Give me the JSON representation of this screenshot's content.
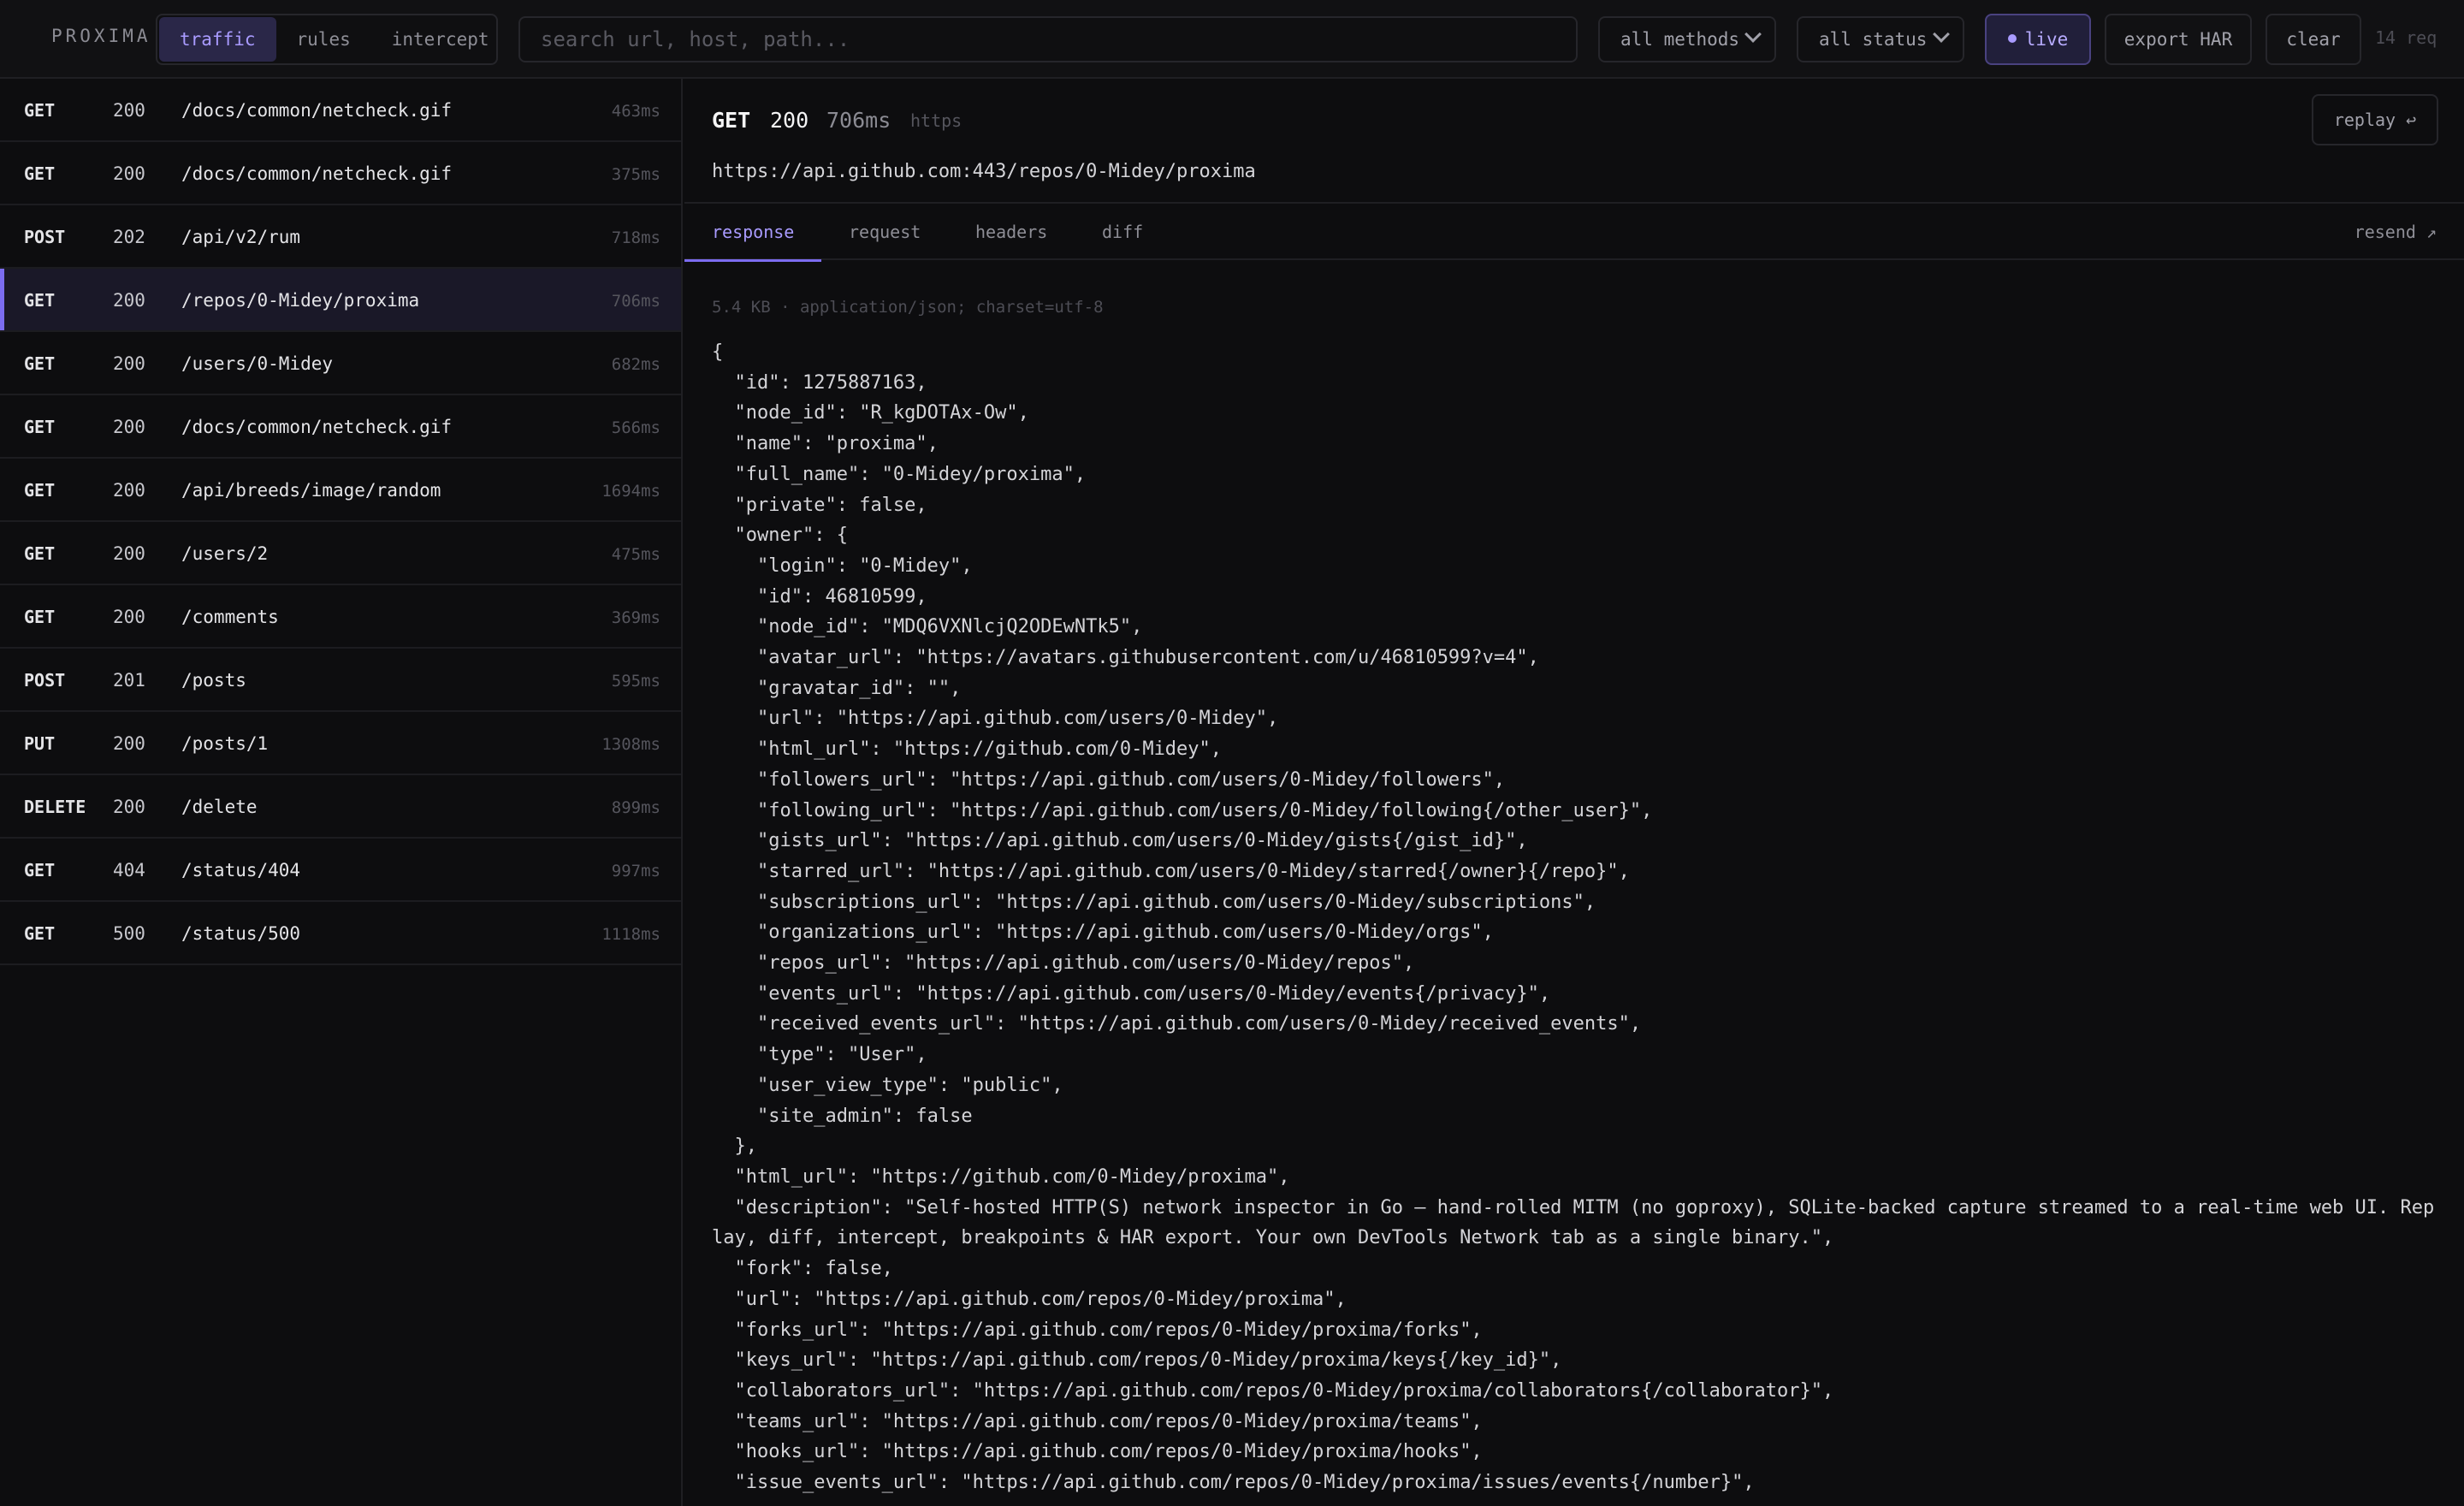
{
  "app": {
    "brand": "PROXIMA"
  },
  "nav": {
    "tabs": [
      "traffic",
      "rules",
      "intercept"
    ],
    "active": "traffic"
  },
  "search": {
    "placeholder": "search url, host, path...",
    "value": ""
  },
  "filters": {
    "methods": "all methods",
    "status": "all status"
  },
  "toolbar": {
    "live_label": "live",
    "export_label": "export HAR",
    "clear_label": "clear",
    "req_count": "14 req"
  },
  "colors": {
    "accent": "#7c6cf0",
    "accent_text": "#a99bff"
  },
  "requests": [
    {
      "method": "GET",
      "status": "200",
      "path": "/docs/common/netcheck.gif",
      "time": "463ms"
    },
    {
      "method": "GET",
      "status": "200",
      "path": "/docs/common/netcheck.gif",
      "time": "375ms"
    },
    {
      "method": "POST",
      "status": "202",
      "path": "/api/v2/rum",
      "time": "718ms"
    },
    {
      "method": "GET",
      "status": "200",
      "path": "/repos/0-Midey/proxima",
      "time": "706ms",
      "selected": true
    },
    {
      "method": "GET",
      "status": "200",
      "path": "/users/0-Midey",
      "time": "682ms"
    },
    {
      "method": "GET",
      "status": "200",
      "path": "/docs/common/netcheck.gif",
      "time": "566ms"
    },
    {
      "method": "GET",
      "status": "200",
      "path": "/api/breeds/image/random",
      "time": "1694ms"
    },
    {
      "method": "GET",
      "status": "200",
      "path": "/users/2",
      "time": "475ms"
    },
    {
      "method": "GET",
      "status": "200",
      "path": "/comments",
      "time": "369ms"
    },
    {
      "method": "POST",
      "status": "201",
      "path": "/posts",
      "time": "595ms"
    },
    {
      "method": "PUT",
      "status": "200",
      "path": "/posts/1",
      "time": "1308ms"
    },
    {
      "method": "DELETE",
      "status": "200",
      "path": "/delete",
      "time": "899ms"
    },
    {
      "method": "GET",
      "status": "404",
      "path": "/status/404",
      "time": "997ms"
    },
    {
      "method": "GET",
      "status": "500",
      "path": "/status/500",
      "time": "1118ms"
    }
  ],
  "detail": {
    "method": "GET",
    "status": "200",
    "time": "706ms",
    "protocol": "https",
    "replay_label": "replay ↩",
    "url": "https://api.github.com:443/repos/0-Midey/proxima",
    "tabs": [
      "response",
      "request",
      "headers",
      "diff"
    ],
    "active_tab": "response",
    "resend_label": "resend ↗",
    "meta": "5.4 KB · application/json; charset=utf-8",
    "body_lines": [
      "{",
      "  \"id\": 1275887163,",
      "  \"node_id\": \"R_kgDOTAx-Ow\",",
      "  \"name\": \"proxima\",",
      "  \"full_name\": \"0-Midey/proxima\",",
      "  \"private\": false,",
      "  \"owner\": {",
      "    \"login\": \"0-Midey\",",
      "    \"id\": 46810599,",
      "    \"node_id\": \"MDQ6VXNlcjQ2ODEwNTk5\",",
      "    \"avatar_url\": \"https://avatars.githubusercontent.com/u/46810599?v=4\",",
      "    \"gravatar_id\": \"\",",
      "    \"url\": \"https://api.github.com/users/0-Midey\",",
      "    \"html_url\": \"https://github.com/0-Midey\",",
      "    \"followers_url\": \"https://api.github.com/users/0-Midey/followers\",",
      "    \"following_url\": \"https://api.github.com/users/0-Midey/following{/other_user}\",",
      "    \"gists_url\": \"https://api.github.com/users/0-Midey/gists{/gist_id}\",",
      "    \"starred_url\": \"https://api.github.com/users/0-Midey/starred{/owner}{/repo}\",",
      "    \"subscriptions_url\": \"https://api.github.com/users/0-Midey/subscriptions\",",
      "    \"organizations_url\": \"https://api.github.com/users/0-Midey/orgs\",",
      "    \"repos_url\": \"https://api.github.com/users/0-Midey/repos\",",
      "    \"events_url\": \"https://api.github.com/users/0-Midey/events{/privacy}\",",
      "    \"received_events_url\": \"https://api.github.com/users/0-Midey/received_events\",",
      "    \"type\": \"User\",",
      "    \"user_view_type\": \"public\",",
      "    \"site_admin\": false",
      "  },",
      "  \"html_url\": \"https://github.com/0-Midey/proxima\",",
      "  \"description\": \"Self-hosted HTTP(S) network inspector in Go — hand-rolled MITM (no goproxy), SQLite-backed capture streamed to a real-time web UI. Replay, diff, intercept, breakpoints & HAR export. Your own DevTools Network tab as a single binary.\",",
      "  \"fork\": false,",
      "  \"url\": \"https://api.github.com/repos/0-Midey/proxima\",",
      "  \"forks_url\": \"https://api.github.com/repos/0-Midey/proxima/forks\",",
      "  \"keys_url\": \"https://api.github.com/repos/0-Midey/proxima/keys{/key_id}\",",
      "  \"collaborators_url\": \"https://api.github.com/repos/0-Midey/proxima/collaborators{/collaborator}\",",
      "  \"teams_url\": \"https://api.github.com/repos/0-Midey/proxima/teams\",",
      "  \"hooks_url\": \"https://api.github.com/repos/0-Midey/proxima/hooks\",",
      "  \"issue_events_url\": \"https://api.github.com/repos/0-Midey/proxima/issues/events{/number}\","
    ]
  }
}
